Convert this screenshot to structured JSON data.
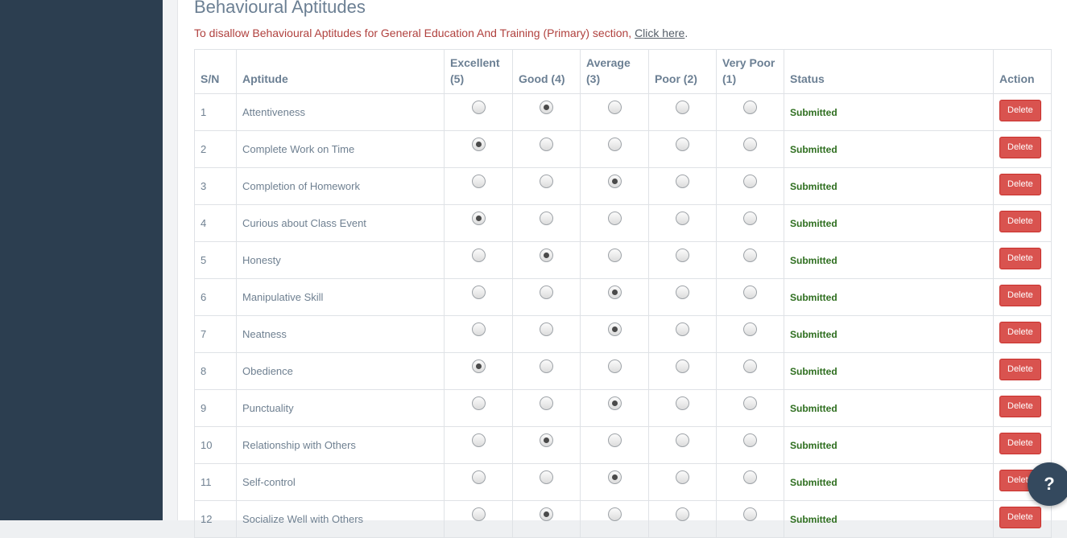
{
  "page": {
    "title": "Behavioural Aptitudes",
    "notice_text": "To disallow Behavioural Aptitudes for General Education And Training (Primary) section, ",
    "notice_link": "Click here",
    "notice_period": "."
  },
  "table": {
    "headers": {
      "sn": "S/N",
      "aptitude": "Aptitude",
      "excellent_1": "Excellent",
      "excellent_2": "(5)",
      "good": "Good (4)",
      "average_1": "Average",
      "average_2": "(3)",
      "poor": "Poor (2)",
      "very_poor_1": "Very Poor",
      "very_poor_2": "(1)",
      "status": "Status",
      "action": "Action"
    },
    "rating_levels": [
      "excellent",
      "good",
      "average",
      "poor",
      "very-poor"
    ],
    "delete_label": "Delete",
    "rows": [
      {
        "sn": "1",
        "aptitude": "Attentiveness",
        "selected": 1,
        "status": "Submitted"
      },
      {
        "sn": "2",
        "aptitude": "Complete Work on Time",
        "selected": 0,
        "status": "Submitted"
      },
      {
        "sn": "3",
        "aptitude": "Completion of Homework",
        "selected": 2,
        "status": "Submitted"
      },
      {
        "sn": "4",
        "aptitude": "Curious about Class Event",
        "selected": 0,
        "status": "Submitted"
      },
      {
        "sn": "5",
        "aptitude": "Honesty",
        "selected": 1,
        "status": "Submitted"
      },
      {
        "sn": "6",
        "aptitude": "Manipulative Skill",
        "selected": 2,
        "status": "Submitted"
      },
      {
        "sn": "7",
        "aptitude": "Neatness",
        "selected": 2,
        "status": "Submitted"
      },
      {
        "sn": "8",
        "aptitude": "Obedience",
        "selected": 0,
        "status": "Submitted"
      },
      {
        "sn": "9",
        "aptitude": "Punctuality",
        "selected": 2,
        "status": "Submitted"
      },
      {
        "sn": "10",
        "aptitude": "Relationship with Others",
        "selected": 1,
        "status": "Submitted"
      },
      {
        "sn": "11",
        "aptitude": "Self-control",
        "selected": 2,
        "status": "Submitted"
      },
      {
        "sn": "12",
        "aptitude": "Socialize Well with Others",
        "selected": 1,
        "status": "Submitted"
      }
    ]
  },
  "help_button": {
    "label": "?",
    "icon": "question-mark-icon"
  },
  "colors": {
    "sidebar": "#2c3e50",
    "delete_button": "#d9534f",
    "status_text": "#2e6e1f",
    "notice_text": "#b0413e"
  }
}
